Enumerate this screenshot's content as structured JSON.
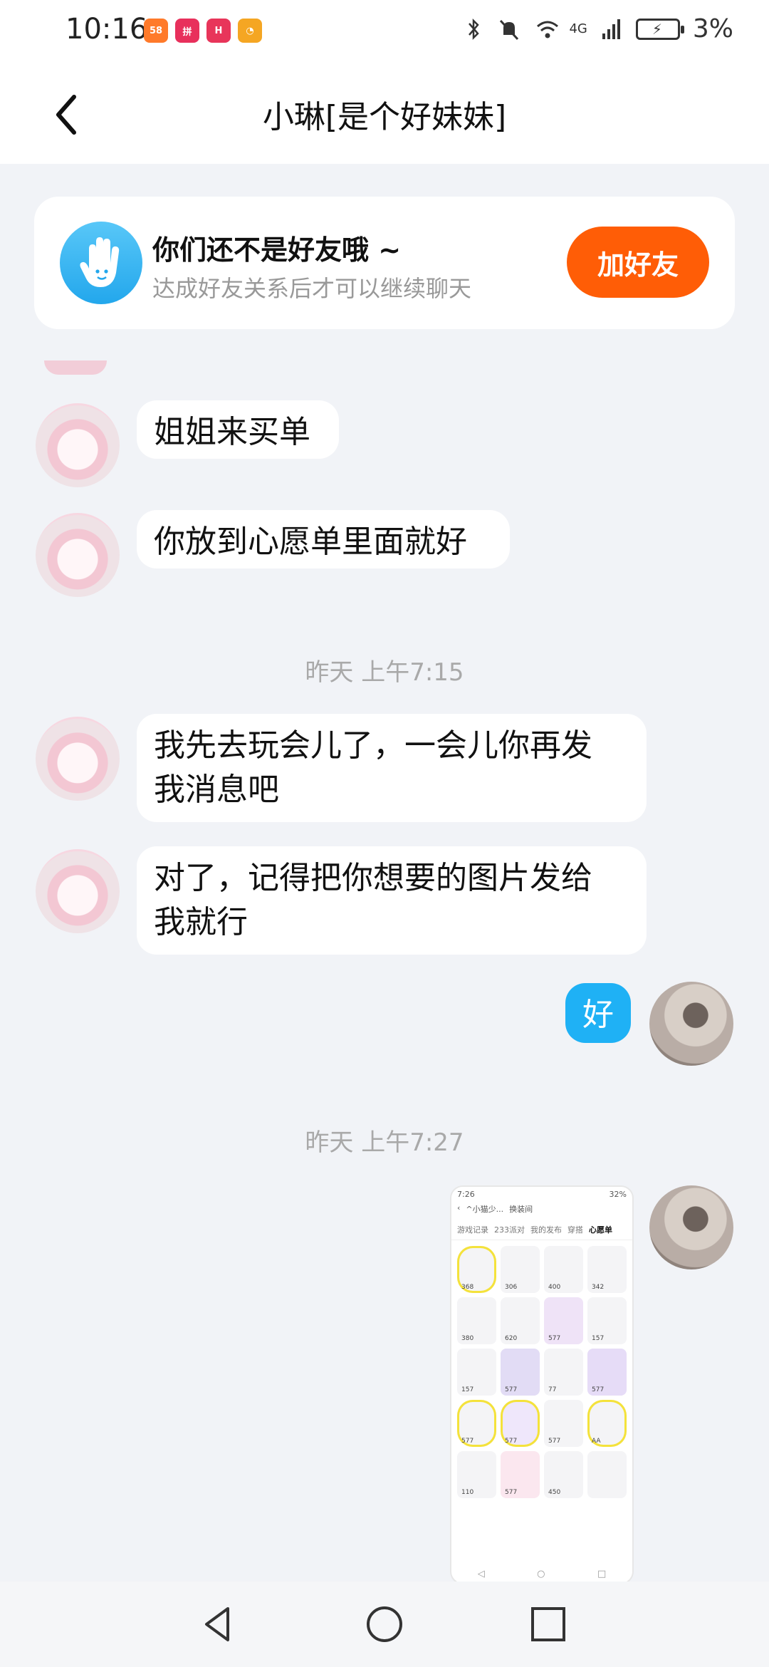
{
  "status": {
    "time": "10:16",
    "battery": "3%",
    "network": "4G"
  },
  "header": {
    "title": "小琳[是个好妹妹]"
  },
  "friend_banner": {
    "title": "你们还不是好友哦 ~",
    "subtitle": "达成好友关系后才可以继续聊天",
    "button": "加好友"
  },
  "messages": {
    "m1": "姐姐来买单",
    "m2": "你放到心愿单里面就好",
    "ts1": "昨天 上午7:15",
    "m3_line1": "我先去玩会儿了，一会儿你再发",
    "m3_line2": "我消息吧",
    "m4_line1": "对了，记得把你想要的图片发给",
    "m4_line2": "我就行",
    "m5": "好",
    "ts2": "昨天 上午7:27"
  },
  "shared_image": {
    "time": "7:26",
    "title": "^小猫少...",
    "action1": "换装间",
    "battery": "32%",
    "tabs": [
      "游戏记录",
      "233派对",
      "我的发布",
      "穿搭",
      "心愿单"
    ],
    "prices": [
      "368",
      "306",
      "400",
      "342",
      "380",
      "620",
      "577",
      "157",
      "157",
      "577",
      "77",
      "577",
      "577",
      "577",
      "577",
      "AA",
      "110",
      "577",
      "450",
      ""
    ]
  },
  "colors": {
    "accent_orange": "#ff5d06",
    "bubble_blue": "#1fb1f5",
    "background": "#f1f3f7"
  }
}
